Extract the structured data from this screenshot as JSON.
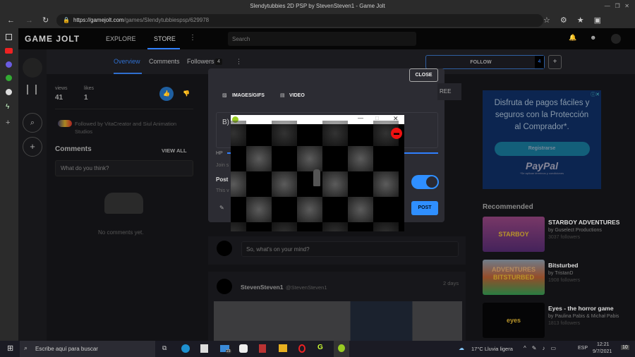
{
  "window": {
    "title": "Slendytubbies 2D PSP by StevenSteven1 - Game Jolt"
  },
  "browser": {
    "url_domain": "https://gamejolt.com",
    "url_path": "/games/Slendytubbiespsp/629978"
  },
  "header": {
    "logo": "GAME JOLT",
    "explore": "EXPLORE",
    "store": "STORE",
    "search_placeholder": "Search"
  },
  "subnav": {
    "tabs": [
      {
        "label": "Overview"
      },
      {
        "label": "Comments"
      },
      {
        "label": "Followers",
        "badge": "4"
      }
    ],
    "follow_label": "FOLLOW",
    "follow_count": "4",
    "plus": "+"
  },
  "stats": {
    "views_label": "views",
    "views": "41",
    "likes_label": "likes",
    "likes": "1"
  },
  "followed_by": "Followed by VitaCreator and Siul Animation Studios",
  "comments": {
    "title": "Comments",
    "view_all": "VIEW ALL",
    "placeholder": "What do you think?",
    "empty": "No comments yet."
  },
  "modal": {
    "close": "CLOSE",
    "images": "IMAGES/GIFS",
    "video": "VIDEO",
    "text_partial": "B)",
    "hp": "HP",
    "join": "Join s",
    "post_heading": "Post",
    "post_sub": "This v",
    "post_button": "POST",
    "behind_label": "REE",
    "toggle_on": true
  },
  "feed": {
    "placeholder": "So, what's on your mind?",
    "post_user": "StevenSteven1",
    "post_handle": "@StevenSteven1",
    "post_time": "2 days"
  },
  "ad": {
    "text": "Disfruta de pagos fáciles y seguros con la Protección al Comprador*.",
    "button": "Registrarse",
    "brand": "PayPal",
    "fine": "*Se aplican términos y condiciones"
  },
  "recommended": {
    "title": "Recommended",
    "items": [
      {
        "name": "STARBOY ADVENTURES",
        "by": "by Guselect Productions",
        "followers": "3037 followers",
        "thumb": "STARBOY ADVENTURES"
      },
      {
        "name": "Bitsturbed",
        "by": "by TristanD",
        "followers": "1908 followers",
        "thumb": "BITSTURBED"
      },
      {
        "name": "Eyes - the horror game",
        "by": "by Paulina Pabis & Michał Pabis",
        "followers": "1813 followers",
        "thumb": "eyes"
      }
    ]
  },
  "taskbar": {
    "search": "Escribe aquí para buscar",
    "mail_badge": "23",
    "weather": "17°C  Lluvia ligera",
    "lang": "ESP",
    "time": "12:21",
    "date": "9/7/2021",
    "notif": "10"
  },
  "colors": {
    "accent": "#2f7fff",
    "ad_bg": "#0c2550"
  }
}
